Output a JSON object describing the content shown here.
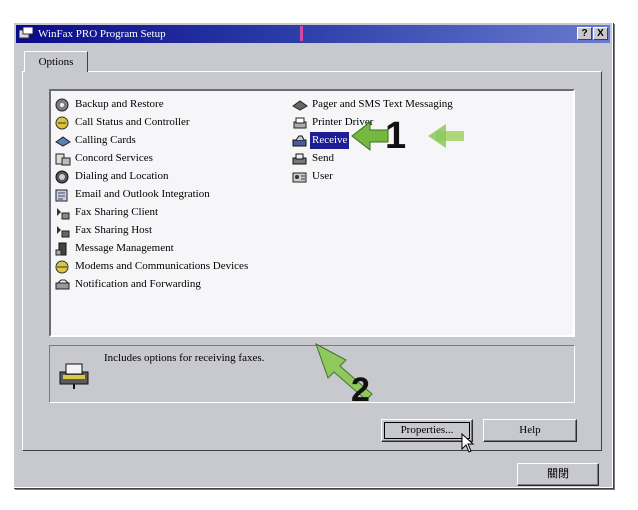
{
  "window": {
    "title": "WinFax PRO Program Setup",
    "help_glyph": "?",
    "close_glyph": "X"
  },
  "tabs": [
    {
      "label": "Options",
      "active": true
    }
  ],
  "options_list": {
    "column1": [
      {
        "label": "Backup and Restore",
        "icon": "backup-icon"
      },
      {
        "label": "Call Status and Controller",
        "icon": "call-status-icon"
      },
      {
        "label": "Calling Cards",
        "icon": "calling-card-icon"
      },
      {
        "label": "Concord Services",
        "icon": "concord-icon"
      },
      {
        "label": "Dialing and Location",
        "icon": "dialing-icon"
      },
      {
        "label": "Email and Outlook Integration",
        "icon": "email-icon"
      },
      {
        "label": "Fax Sharing Client",
        "icon": "fax-client-icon"
      },
      {
        "label": "Fax Sharing Host",
        "icon": "fax-host-icon"
      },
      {
        "label": "Message Management",
        "icon": "message-icon"
      },
      {
        "label": "Modems and Communications Devices",
        "icon": "modem-icon"
      },
      {
        "label": "Notification and Forwarding",
        "icon": "notification-icon"
      }
    ],
    "column2": [
      {
        "label": "Pager and SMS Text Messaging",
        "icon": "pager-icon"
      },
      {
        "label": "Printer Driver",
        "icon": "printer-icon"
      },
      {
        "label": "Receive",
        "icon": "receive-icon",
        "selected": true
      },
      {
        "label": "Send",
        "icon": "send-icon"
      },
      {
        "label": "User",
        "icon": "user-icon"
      }
    ]
  },
  "description": {
    "text": "Includes options for receiving faxes.",
    "icon": "fax-machine-icon"
  },
  "buttons": {
    "properties": "Properties...",
    "help": "Help",
    "close": "關閉"
  },
  "annotations": {
    "step1": "1",
    "step2": "2"
  }
}
